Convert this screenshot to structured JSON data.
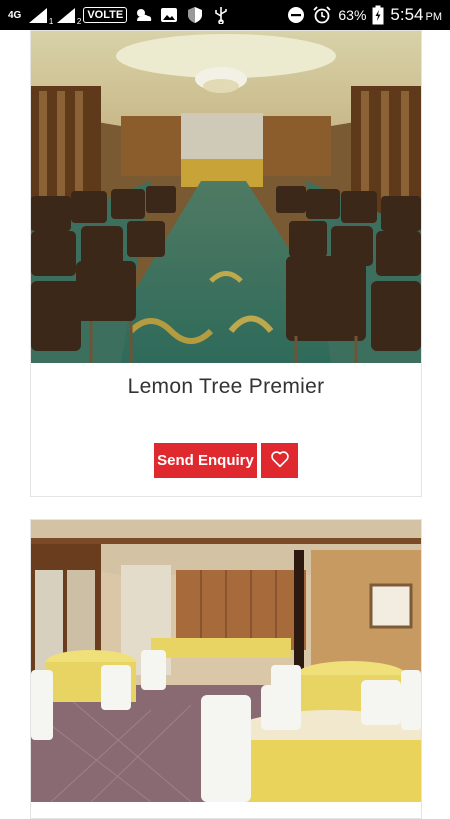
{
  "status_bar": {
    "network": "4G",
    "sim1": "1",
    "sim2": "2",
    "volte": "VOLTE",
    "battery": "63%",
    "time": "5:54",
    "ampm": "PM"
  },
  "venues": [
    {
      "title": "Lemon Tree Premier",
      "enquiry_label": "Send Enquiry",
      "favorite_icon": "heart-outline-icon"
    },
    {
      "title": ""
    }
  ],
  "colors": {
    "accent": "#e0292f",
    "status_bar": "#000000",
    "title_text": "#333333"
  }
}
